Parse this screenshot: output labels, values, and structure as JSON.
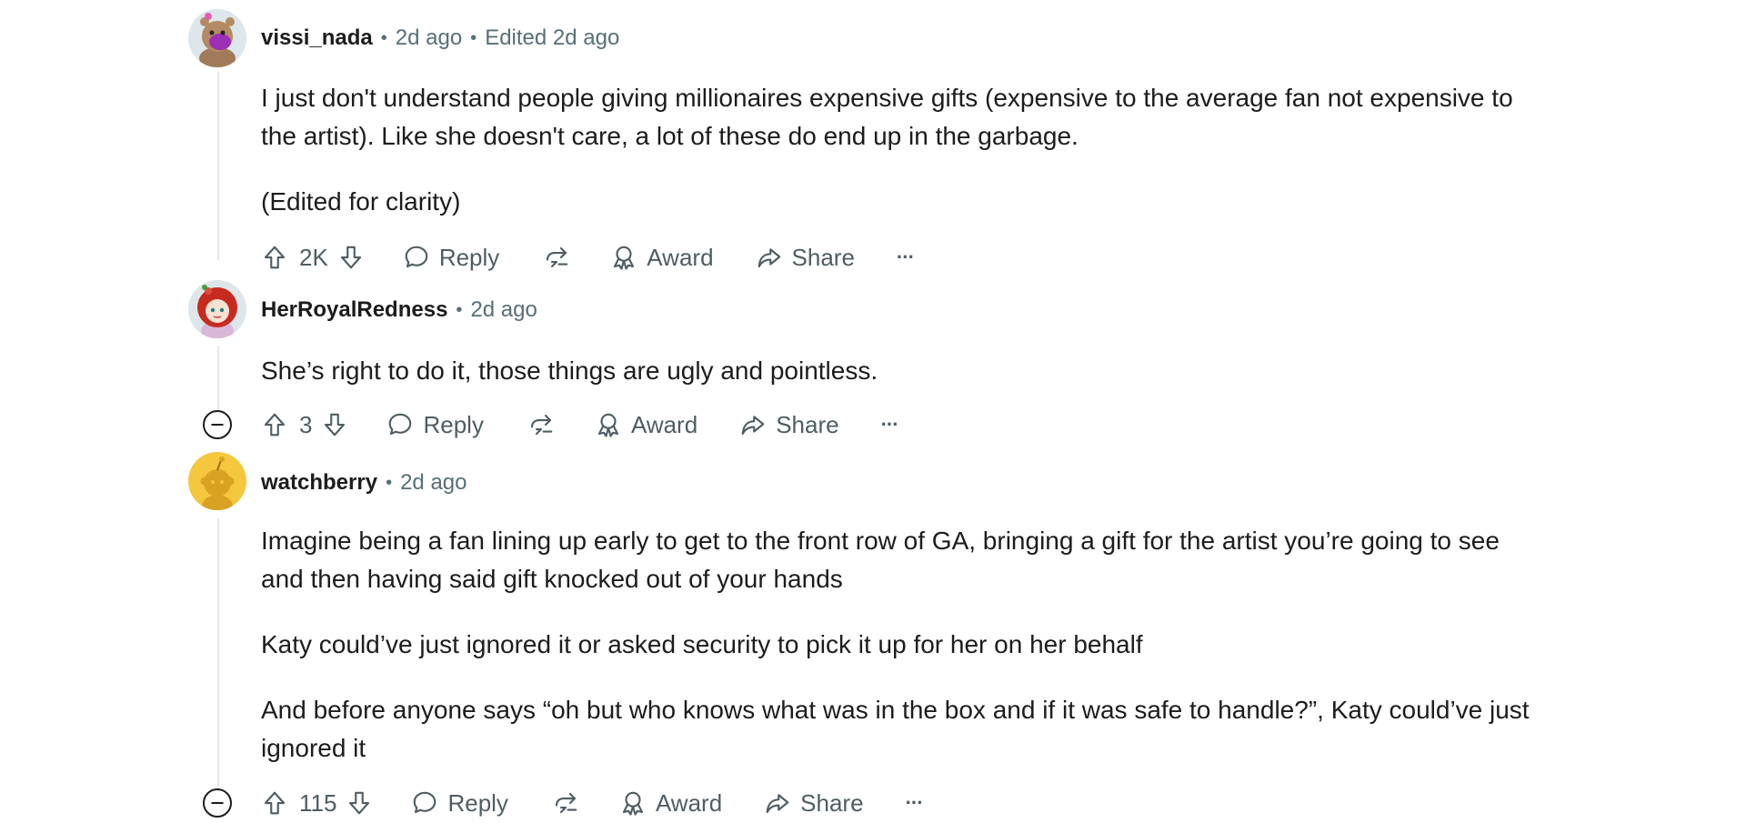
{
  "comments": [
    {
      "author": "vissi_nada",
      "time": "2d ago",
      "edited": "Edited 2d ago",
      "paragraphs": [
        "I just don't understand people giving millionaires expensive gifts (expensive to the average fan not expensive to the artist). Like she doesn't care, a lot of these do end up in the garbage.",
        "(Edited for clarity)"
      ],
      "score": "2K",
      "avatar_icon": "snoo-avatar-purple-icon"
    },
    {
      "author": "HerRoyalRedness",
      "time": "2d ago",
      "paragraphs": [
        "She’s right to do it, those things are ugly and pointless."
      ],
      "score": "3",
      "avatar_icon": "snoo-avatar-red-hair-icon"
    },
    {
      "author": "watchberry",
      "time": "2d ago",
      "paragraphs": [
        "Imagine being a fan lining up early to get to the front row of GA, bringing a gift for the artist you’re going to see and then having said gift knocked out of your hands",
        "Katy could’ve just ignored it or asked security to pick it up for her on her behalf",
        "And before anyone says “oh but who knows what was in the box and if it was safe to handle?”, Katy could’ve just ignored it"
      ],
      "score": "115",
      "avatar_icon": "default-snoo-avatar-icon"
    }
  ],
  "actions": {
    "reply": "Reply",
    "award": "Award",
    "share": "Share",
    "more": "···"
  },
  "colors": {
    "text": "#1c1c1c",
    "meta": "#576f76",
    "action": "#4f5d63",
    "thread_line": "#e5e8ea",
    "default_avatar_bg": "#f5c73f"
  }
}
